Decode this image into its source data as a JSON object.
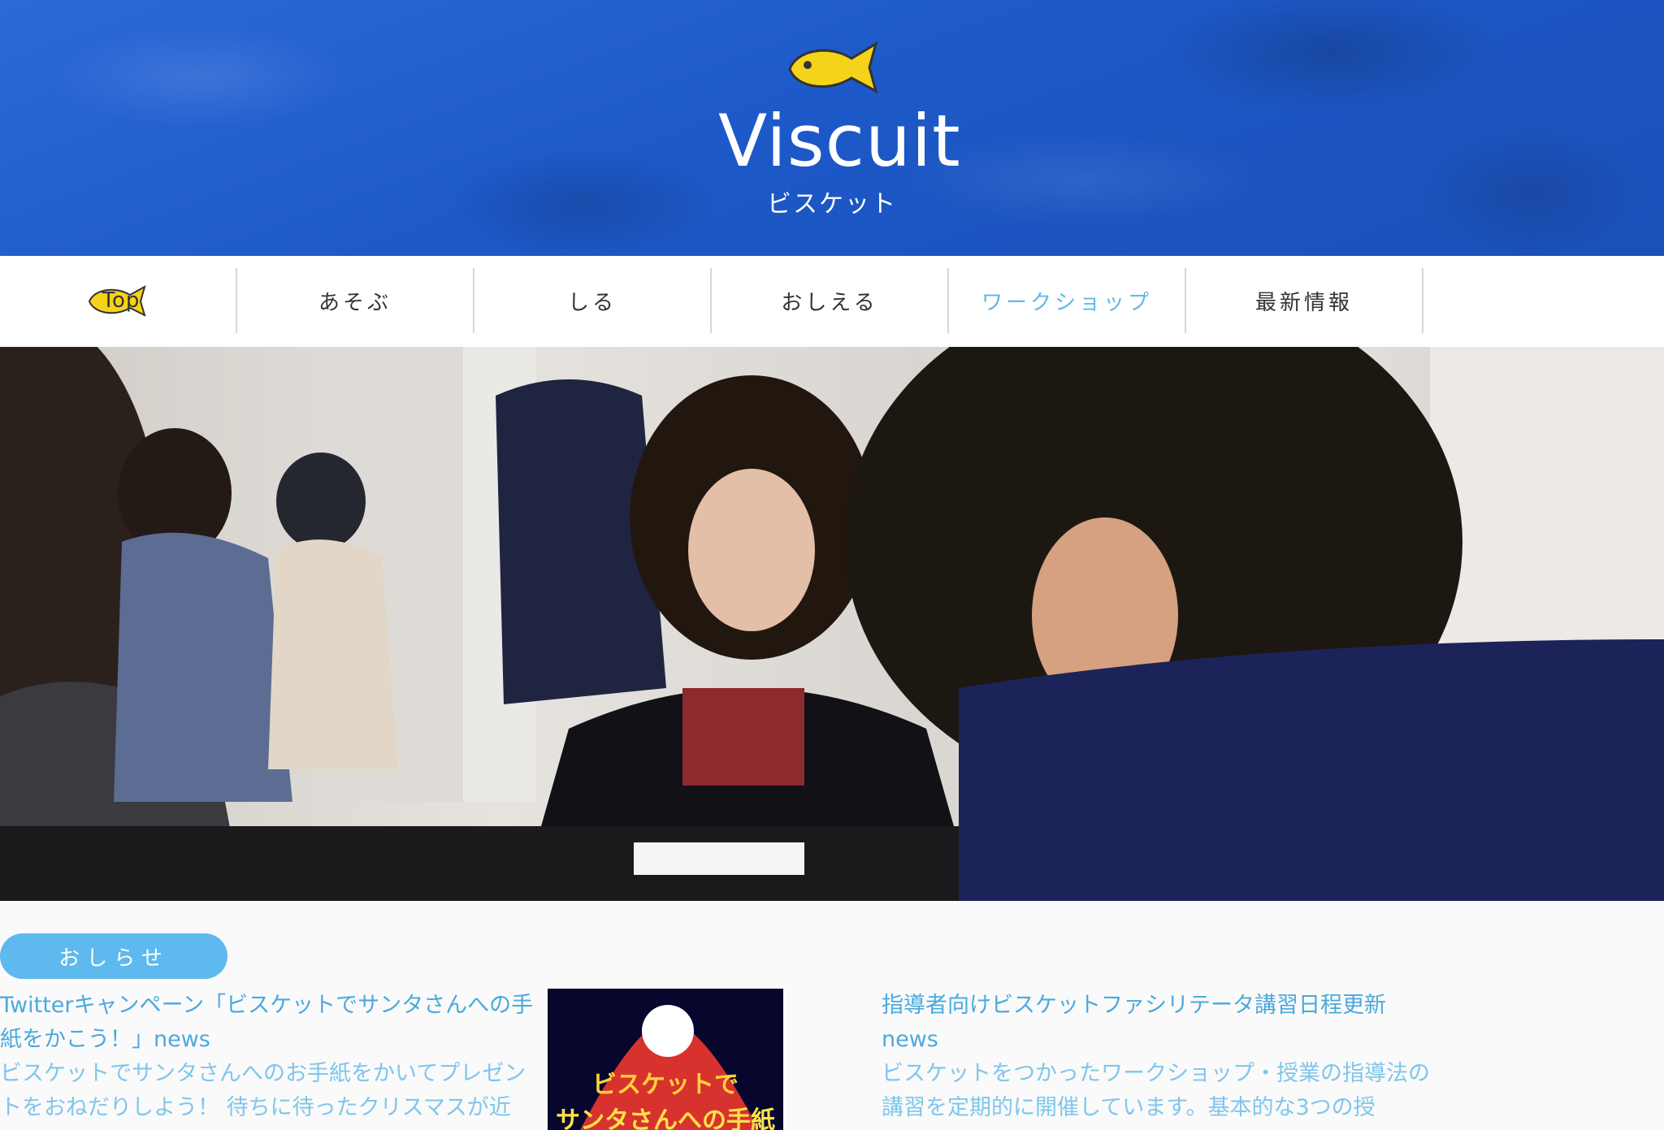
{
  "header": {
    "logo_title": "Viscuit",
    "logo_subtitle": "ビスケット",
    "background_color": "#1f5cc8",
    "fish_color": "#f5d31a"
  },
  "nav": {
    "items": [
      {
        "label": "Top"
      },
      {
        "label": "あそぶ"
      },
      {
        "label": "しる"
      },
      {
        "label": "おしえる"
      },
      {
        "label": "ワークショップ"
      },
      {
        "label": "最新情報"
      }
    ]
  },
  "hero": {
    "icon": "photo"
  },
  "notice": {
    "badge_label": "おしらせ",
    "news": [
      {
        "title": "Twitterキャンペーン「ビスケットでサンタさんへの手紙をかこう！」news",
        "excerpt": "ビスケットでサンタさんへのお手紙をかいてプレゼントをおねだりしよう！ 待ちに待ったクリスマスが近",
        "thumb_text": "ビスケットで サンタさんへの手紙"
      },
      {
        "title": "指導者向けビスケットファシリテータ講習日程更新 news",
        "excerpt": "ビスケットをつかったワークショップ・授業の指導法の講習を定期的に開催しています。基本的な3つの授"
      }
    ]
  },
  "colors": {
    "accent_blue": "#5db9ee",
    "link_blue": "#4ba9dd",
    "nav_text": "#333333"
  }
}
